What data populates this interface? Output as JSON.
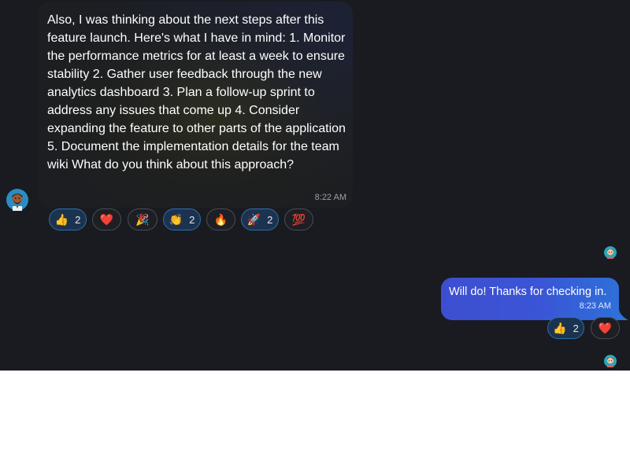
{
  "messages": {
    "incoming": {
      "text": "Also, I was thinking about the next steps after this feature launch. Here's what I have in mind: 1. Monitor the performance metrics for at least a week to ensure stability 2. Gather user feedback through the new analytics dashboard 3. Plan a follow-up sprint to address any issues that come up 4. Consider expanding the feature to other parts of the application 5. Document the implementation details for the team wiki What do you think about this approach?",
      "time": "8:22 AM",
      "avatar_icon": "bearded-person-avatar-icon",
      "reactions": [
        {
          "emoji": "👍",
          "count": "2",
          "active": true
        },
        {
          "emoji": "❤️",
          "count": "",
          "active": false
        },
        {
          "emoji": "🎉",
          "count": "",
          "active": false
        },
        {
          "emoji": "👏",
          "count": "2",
          "active": true
        },
        {
          "emoji": "🔥",
          "count": "",
          "active": false
        },
        {
          "emoji": "🚀",
          "count": "2",
          "active": true
        },
        {
          "emoji": "💯",
          "count": "",
          "active": false
        }
      ]
    },
    "outgoing": {
      "text": "Will do! Thanks for checking in.",
      "time": "8:23 AM",
      "read_avatar_icon": "person-avatar-icon",
      "reactions": [
        {
          "emoji": "👍",
          "count": "2",
          "active": true
        },
        {
          "emoji": "❤️",
          "count": "",
          "active": false
        }
      ]
    }
  },
  "colors": {
    "chat_background": "#191b20",
    "outgoing_bubble": "#3a55d6",
    "active_reaction_border": "#2f6ea8"
  }
}
